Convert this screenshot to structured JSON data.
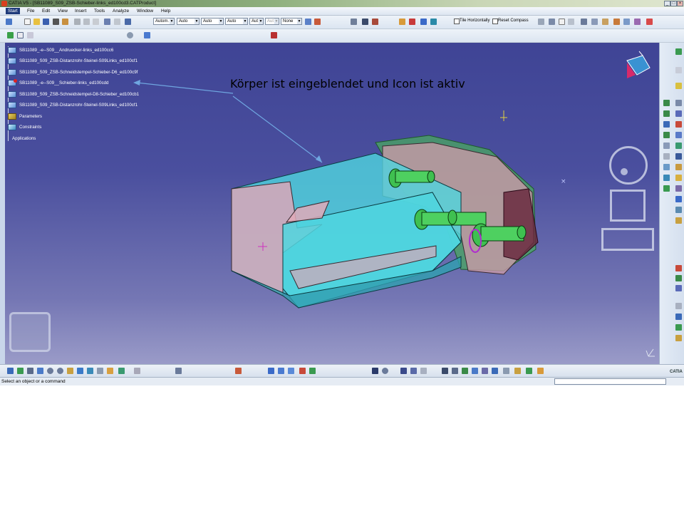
{
  "window": {
    "title": "CATIA V5 - [SB11089_S09_ZSB-Schieber-links_ed100cd3.CATProduct]",
    "controls": [
      "_",
      "□",
      "×"
    ]
  },
  "menu": [
    "Start",
    "File",
    "Edit",
    "View",
    "Insert",
    "Tools",
    "Analyze",
    "Window",
    "Help"
  ],
  "toolbar": {
    "combos": [
      "Autom.",
      "Auto",
      "Auto",
      "Auto",
      "Aut",
      "Aut",
      "None"
    ],
    "tile_horizontally_label": "Tile Horizontally",
    "reset_compass_label": "Reset Compass"
  },
  "tree": {
    "items": [
      {
        "label": "SB11089_-e--S09__Andruecker-links_ed100cc6",
        "active": false
      },
      {
        "label": "SB11089_S09_ZSB-Distanzrohr-Steinel-S09Links_ed100cf1",
        "active": false
      },
      {
        "label": "SB11089_S09_ZSB-Schneidstempel-Schieber-D6_ed100c9f",
        "active": false
      },
      {
        "label": "SB11089_-e--S09__Schieber-links_ed100cdd",
        "active": true
      },
      {
        "label": "SB11089_S09_ZSB-Schneidstempel-D8-Schieber_ed100cb1",
        "active": false
      },
      {
        "label": "SB11089_S09_ZSB-Distanzrohr-Steinel-S09Links_ed100cf1",
        "active": false
      }
    ],
    "parameters_label": "Parameters",
    "constraints_label": "Constraints",
    "applications_label": "Applications"
  },
  "annotation": {
    "text": "Körper ist eingeblendet und Icon ist aktiv"
  },
  "colors": {
    "viewport_top": "#3f4495",
    "viewport_bottom": "#9a9bc8",
    "cyan_body": "#4fd6df",
    "pink_body": "#d9a7b8",
    "green_parts": "#4ec35a",
    "annotation_arrow": "#6fa6e0"
  },
  "swatch_colors": [
    "#3ee0e0",
    "#b0c8e8",
    "#8fa4c0",
    "#b8a888",
    "#e0c880",
    "#c8d87a",
    "#1ee060",
    "#10c040",
    "#2a8a30",
    "#c0c0c8",
    "#6878a8"
  ],
  "status": {
    "message": "Select an object or a command"
  },
  "brand": "CATIA"
}
